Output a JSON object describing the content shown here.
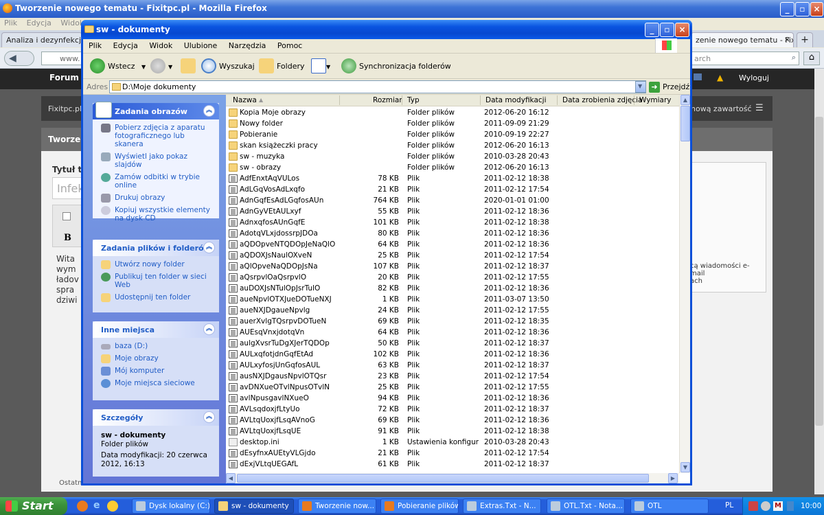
{
  "firefox": {
    "title": "Tworzenie nowego tematu - Fixitpc.pl - Mozilla Firefox",
    "menu": [
      "Plik",
      "Edycja",
      "Widok"
    ],
    "tabs": [
      {
        "label": "Analiza i dezynfekcja"
      },
      {
        "label": "zenie nowego tematu - Fixi..."
      }
    ],
    "tab_close": "×",
    "new_tab": "+",
    "url_partial": "www.",
    "search_partial": "arch",
    "forum_label": "Forum",
    "logout": "Wyloguj",
    "site_name": "Fixitpc.pl",
    "new_content": "nową zawartość",
    "section_title": "Tworzen",
    "topic_label": "Tytuł te",
    "topic_placeholder": "Infek",
    "bold_btn": "B",
    "editor_lines": [
      "Wita",
      "wym",
      "ładov",
      "spra",
      "dziwi"
    ],
    "side_text_1": "cą wiadomości e-mail",
    "side_text_2": "ach",
    "status_text": "Ostatn"
  },
  "explorer": {
    "title": "sw - dokumenty",
    "menu": [
      "Plik",
      "Edycja",
      "Widok",
      "Ulubione",
      "Narzędzia",
      "Pomoc"
    ],
    "toolbar": {
      "back": "Wstecz",
      "search": "Wyszukaj",
      "folders": "Foldery",
      "sync": "Synchronizacja folderów"
    },
    "address_label": "Adres",
    "address_value": "D:\\Moje dokumenty",
    "go_label": "Przejdź",
    "left_pane": {
      "picture_tasks": {
        "title": "Zadania obrazów",
        "items": [
          "Pobierz zdjęcia z aparatu fotograficznego lub skanera",
          "Wyświetl jako pokaz slajdów",
          "Zamów odbitki w trybie online",
          "Drukuj obrazy",
          "Kopiuj wszystkie elementy na dysk CD"
        ]
      },
      "file_tasks": {
        "title": "Zadania plików i folderów",
        "items": [
          "Utwórz nowy folder",
          "Publikuj ten folder w sieci Web",
          "Udostępnij ten folder"
        ]
      },
      "other_places": {
        "title": "Inne miejsca",
        "items": [
          "baza (D:)",
          "Moje obrazy",
          "Mój komputer",
          "Moje miejsca sieciowe"
        ]
      },
      "details": {
        "title": "Szczegóły",
        "name": "sw - dokumenty",
        "type": "Folder plików",
        "modified": "Data modyfikacji: 20 czerwca 2012, 16:13"
      }
    },
    "columns": [
      "Nazwa",
      "Rozmiar",
      "Typ",
      "Data modyfikacji",
      "Data zrobienia zdjęcia",
      "Wymiary"
    ],
    "files": [
      {
        "name": "Kopia Moje obrazy",
        "size": "",
        "type": "Folder plików",
        "date": "2012-06-20 16:12",
        "kind": "folder"
      },
      {
        "name": "Nowy folder",
        "size": "",
        "type": "Folder plików",
        "date": "2011-09-09 21:29",
        "kind": "folder"
      },
      {
        "name": "Pobieranie",
        "size": "",
        "type": "Folder plików",
        "date": "2010-09-19 22:27",
        "kind": "folder"
      },
      {
        "name": "skan książeczki pracy",
        "size": "",
        "type": "Folder plików",
        "date": "2012-06-20 16:13",
        "kind": "folder"
      },
      {
        "name": "sw - muzyka",
        "size": "",
        "type": "Folder plików",
        "date": "2010-03-28 20:43",
        "kind": "folder"
      },
      {
        "name": "sw - obrazy",
        "size": "",
        "type": "Folder plików",
        "date": "2012-06-20 16:13",
        "kind": "folder"
      },
      {
        "name": "AdfEnxtAqVULos",
        "size": "78 KB",
        "type": "Plik",
        "date": "2011-02-12 18:38",
        "kind": "file"
      },
      {
        "name": "AdLGqVosAdLxqfo",
        "size": "21 KB",
        "type": "Plik",
        "date": "2011-02-12 17:54",
        "kind": "file"
      },
      {
        "name": "AdnGqfEsAdLGqfosAUn",
        "size": "764 KB",
        "type": "Plik",
        "date": "2020-01-01 01:00",
        "kind": "file"
      },
      {
        "name": "AdnGyVEtAULxyf",
        "size": "55 KB",
        "type": "Plik",
        "date": "2011-02-12 18:36",
        "kind": "file"
      },
      {
        "name": "AdnxqfosAUnGqfE",
        "size": "101 KB",
        "type": "Plik",
        "date": "2011-02-12 18:38",
        "kind": "file"
      },
      {
        "name": "AdotqVLxjdossrpJDOa",
        "size": "80 KB",
        "type": "Plik",
        "date": "2011-02-12 18:36",
        "kind": "file"
      },
      {
        "name": "aQDOpveNTQDOpJeNaQlO",
        "size": "64 KB",
        "type": "Plik",
        "date": "2011-02-12 18:36",
        "kind": "file"
      },
      {
        "name": "aQDOXJsNaulOXveN",
        "size": "25 KB",
        "type": "Plik",
        "date": "2011-02-12 17:54",
        "kind": "file"
      },
      {
        "name": "aQlOpveNaQDOpJsNa",
        "size": "107 KB",
        "type": "Plik",
        "date": "2011-02-12 18:37",
        "kind": "file"
      },
      {
        "name": "aQsrpvlOaQsrpvlO",
        "size": "20 KB",
        "type": "Plik",
        "date": "2011-02-12 17:55",
        "kind": "file"
      },
      {
        "name": "auDOXJsNTulOpJsrTulO",
        "size": "82 KB",
        "type": "Plik",
        "date": "2011-02-12 18:36",
        "kind": "file"
      },
      {
        "name": "aueNpvlOTXJueDOTueNXJ",
        "size": "1 KB",
        "type": "Plik",
        "date": "2011-03-07 13:50",
        "kind": "file"
      },
      {
        "name": "aueNXJDgaueNpvlg",
        "size": "24 KB",
        "type": "Plik",
        "date": "2011-02-12 17:55",
        "kind": "file"
      },
      {
        "name": "auerXvlgTQsrpvDOTueN",
        "size": "69 KB",
        "type": "Plik",
        "date": "2011-02-12 18:35",
        "kind": "file"
      },
      {
        "name": "AUEsqVnxjdotqVn",
        "size": "64 KB",
        "type": "Plik",
        "date": "2011-02-12 18:36",
        "kind": "file"
      },
      {
        "name": "aulgXvsrTuDgXJerTQDOp",
        "size": "50 KB",
        "type": "Plik",
        "date": "2011-02-12 18:37",
        "kind": "file"
      },
      {
        "name": "AULxqfotjdnGqfEtAd",
        "size": "102 KB",
        "type": "Plik",
        "date": "2011-02-12 18:36",
        "kind": "file"
      },
      {
        "name": "AULxyfosjUnGqfosAUL",
        "size": "63 KB",
        "type": "Plik",
        "date": "2011-02-12 18:37",
        "kind": "file"
      },
      {
        "name": "ausNXJDgausNpvlOTQsr",
        "size": "23 KB",
        "type": "Plik",
        "date": "2011-02-12 17:54",
        "kind": "file"
      },
      {
        "name": "avDNXueOTvlNpusOTvlN",
        "size": "25 KB",
        "type": "Plik",
        "date": "2011-02-12 17:55",
        "kind": "file"
      },
      {
        "name": "avlNpusgavlNXueO",
        "size": "94 KB",
        "type": "Plik",
        "date": "2011-02-12 18:36",
        "kind": "file"
      },
      {
        "name": "AVLsqdoxjfLtyUo",
        "size": "72 KB",
        "type": "Plik",
        "date": "2011-02-12 18:37",
        "kind": "file"
      },
      {
        "name": "AVLtqUoxjfLsqAVnoG",
        "size": "69 KB",
        "type": "Plik",
        "date": "2011-02-12 18:36",
        "kind": "file"
      },
      {
        "name": "AVLtqUoxjfLsqUE",
        "size": "91 KB",
        "type": "Plik",
        "date": "2011-02-12 18:38",
        "kind": "file"
      },
      {
        "name": "desktop.ini",
        "size": "1 KB",
        "type": "Ustawienia konfigur...",
        "date": "2010-03-28 20:43",
        "kind": "ini"
      },
      {
        "name": "dEsyfnxAUEtyVLGjdo",
        "size": "21 KB",
        "type": "Plik",
        "date": "2011-02-12 17:54",
        "kind": "file"
      },
      {
        "name": "dExjVLtqUEGAfL",
        "size": "61 KB",
        "type": "Plik",
        "date": "2011-02-12 18:37",
        "kind": "file"
      }
    ]
  },
  "taskbar": {
    "start": "Start",
    "buttons": [
      {
        "label": "Dysk lokalny (C:)"
      },
      {
        "label": "sw - dokumenty",
        "active": true
      },
      {
        "label": "Tworzenie now..."
      },
      {
        "label": "Pobieranie plików"
      },
      {
        "label": "Extras.Txt - N..."
      },
      {
        "label": "OTL.Txt - Nota..."
      },
      {
        "label": "OTL"
      }
    ],
    "lang": "PL",
    "clock": "10:00"
  },
  "colors": {
    "xp_blue": "#0a54e0",
    "task_link": "#215dc6",
    "start_green": "#3c933c"
  }
}
